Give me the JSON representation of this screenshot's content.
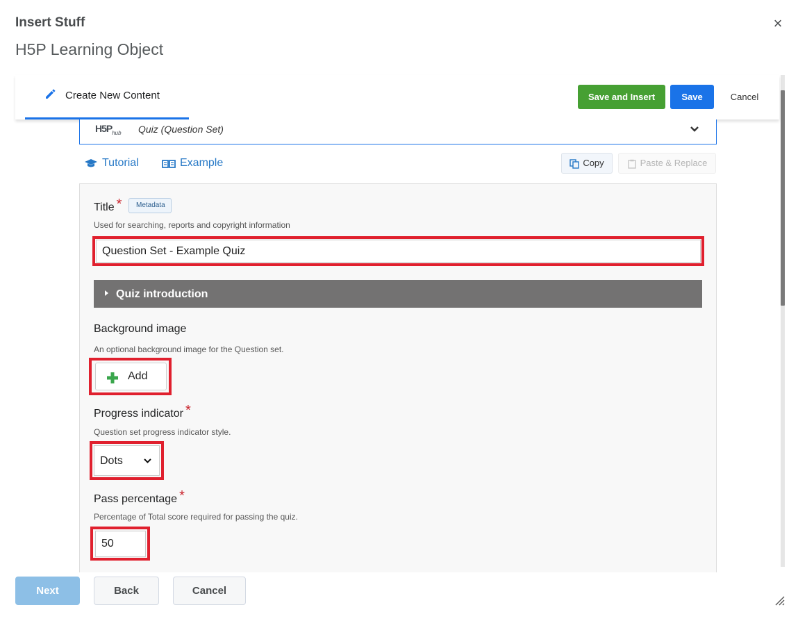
{
  "dialog": {
    "title": "Insert Stuff",
    "subtitle": "H5P Learning Object",
    "close_glyph": "×"
  },
  "topbar": {
    "tab_label": "Create New Content",
    "save_insert_label": "Save and Insert",
    "save_label": "Save",
    "cancel_label": "Cancel"
  },
  "hub": {
    "logo_text": "H5P",
    "logo_sub": "hub",
    "content_type": "Quiz (Question Set)"
  },
  "links": {
    "tutorial": "Tutorial",
    "example": "Example",
    "copy": "Copy",
    "paste_replace": "Paste & Replace"
  },
  "form": {
    "title_label": "Title",
    "required_mark": "*",
    "metadata_label": "Metadata",
    "title_desc": "Used for searching, reports and copyright information",
    "title_value": "Question Set - Example Quiz",
    "intro_label": "Quiz introduction",
    "bg_label": "Background image",
    "bg_desc": "An optional background image for the Question set.",
    "add_label": "Add",
    "progress_label": "Progress indicator",
    "progress_desc": "Question set progress indicator style.",
    "progress_value": "Dots",
    "pass_label": "Pass percentage",
    "pass_desc": "Percentage of Total score required for passing the quiz.",
    "pass_value": "50"
  },
  "footer": {
    "next_label": "Next",
    "back_label": "Back",
    "cancel_label": "Cancel"
  },
  "colors": {
    "accent_blue": "#1a73e8",
    "save_green": "#46a033",
    "highlight_red": "#e0202e",
    "link_blue": "#2678c6"
  },
  "icons": [
    "close-icon",
    "pencil-icon",
    "chevron-down-icon",
    "graduation-cap-icon",
    "book-icon",
    "copy-icon",
    "paste-icon",
    "caret-right-icon",
    "plus-icon",
    "resize-grip-icon"
  ]
}
